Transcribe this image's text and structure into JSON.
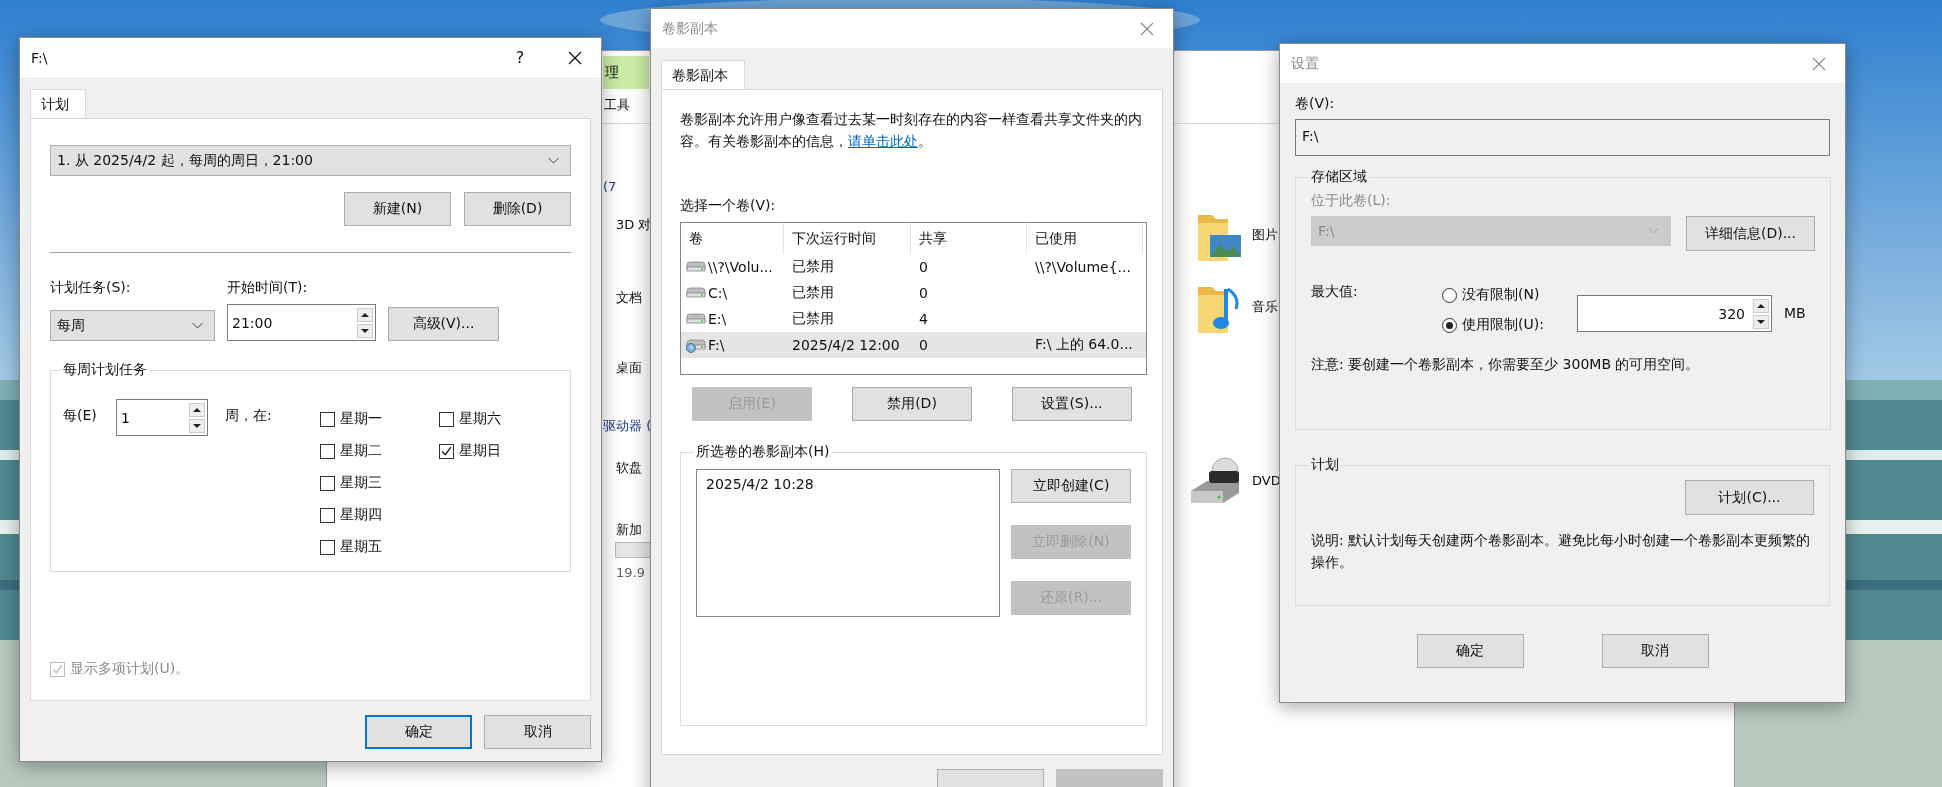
{
  "explorer": {
    "contextual_tab": "理",
    "ribbon_text": "工具",
    "left_items": [
      {
        "kind": "header",
        "text": "(7"
      },
      {
        "kind": "item",
        "text": "3D 对"
      },
      {
        "kind": "item",
        "text": "文档"
      },
      {
        "kind": "item",
        "text": "桌面"
      },
      {
        "kind": "header",
        "text": "驱动器 ("
      },
      {
        "kind": "item",
        "text": "软盘"
      },
      {
        "kind": "drive",
        "text": "新加",
        "detail": "19.9"
      }
    ],
    "right_items": [
      {
        "kind": "pictures",
        "text": "图片"
      },
      {
        "kind": "music",
        "text": "音乐"
      },
      {
        "kind": "dvd",
        "text": "DVD"
      }
    ]
  },
  "schedule_dialog": {
    "title": "F:\\",
    "active": true,
    "help": "?",
    "tabs": [
      {
        "label": "计划",
        "selected": true
      }
    ],
    "schedule_combo": "1. 从 2025/4/2 起，每周的周日，21:00",
    "top_buttons": [
      "新建(N)",
      "删除(D)"
    ],
    "task_label": "计划任务(S):",
    "task_value": "每周",
    "start_label": "开始时间(T):",
    "start_value": "21:00",
    "advanced_button": "高级(V)...",
    "group_title": "每周计划任务",
    "every_label": "每(E)",
    "every_value": "1",
    "weeks_label": "周，在:",
    "days": [
      {
        "label": "星期一",
        "checked": false
      },
      {
        "label": "星期二",
        "checked": false
      },
      {
        "label": "星期三",
        "checked": false
      },
      {
        "label": "星期四",
        "checked": false
      },
      {
        "label": "星期五",
        "checked": false
      },
      {
        "label": "星期六",
        "checked": false
      },
      {
        "label": "星期日",
        "checked": true
      }
    ],
    "multiple": {
      "label": "显示多项计划(U)。",
      "checked": true,
      "disabled": true
    },
    "buttons": [
      {
        "label": "确定",
        "default": true
      },
      {
        "label": "取消",
        "default": false
      }
    ]
  },
  "shadow_dialog": {
    "title": "卷影副本",
    "active": false,
    "tabs": [
      {
        "label": "卷影副本",
        "selected": true
      }
    ],
    "description": "卷影副本允许用户像查看过去某一时刻存在的内容一样查看共享文件夹的内容。有关卷影副本的信息，",
    "link": "请单击此处",
    "after_link": "。",
    "volumes_label": "选择一个卷(V):",
    "columns": [
      "卷",
      "下次运行时间",
      "共享",
      "已使用"
    ],
    "volumes": [
      {
        "kind": "drive",
        "name": "\\\\?\\Volu...",
        "next_run": "已禁用",
        "shares": "0",
        "used": "\\\\?\\Volume{...",
        "selected": false
      },
      {
        "kind": "drive",
        "name": "C:\\",
        "next_run": "已禁用",
        "shares": "0",
        "selected": false
      },
      {
        "kind": "drive",
        "name": "E:\\",
        "next_run": "已禁用",
        "shares": "4",
        "selected": false
      },
      {
        "kind": "scheduled",
        "name": "F:\\",
        "next_run": "2025/4/2 12:00",
        "shares": "0",
        "used": "F:\\ 上的 64.0...",
        "selected": true
      }
    ],
    "volume_buttons": [
      {
        "label": "启用(E)",
        "disabled": true
      },
      {
        "label": "禁用(D)",
        "disabled": false
      },
      {
        "label": "设置(S)...",
        "disabled": false
      }
    ],
    "copies_group": "所选卷的卷影副本(H)",
    "copies": [
      "2025/4/2 10:28"
    ],
    "copy_buttons": [
      {
        "label": "立即创建(C)",
        "disabled": false
      },
      {
        "label": "立即删除(N)",
        "disabled": true
      },
      {
        "label": "还原(R)...",
        "disabled": true
      }
    ],
    "buttons": [
      {
        "disabled": false
      },
      {
        "disabled": true
      }
    ]
  },
  "settings_dialog": {
    "title": "设置",
    "active": false,
    "volume_label": "卷(V):",
    "volume_value": "F:\\",
    "storage_group": "存储区域",
    "location_label": "位于此卷(L):",
    "location_value": "F:\\",
    "location_disabled": true,
    "details_button": "详细信息(D)...",
    "max_label": "最大值:",
    "limits": [
      {
        "label": "没有限制(N)",
        "selected": false
      },
      {
        "label": "使用限制(U):",
        "selected": true
      }
    ],
    "limit_value": "320",
    "unit": "MB",
    "note": "注意: 要创建一个卷影副本，你需要至少 300MB 的可用空间。",
    "schedule_group": "计划",
    "schedule_button": "计划(C)...",
    "description": "说明: 默认计划每天创建两个卷影副本。避免比每小时创建一个卷影副本更频繁的操作。",
    "buttons": [
      "确定",
      "取消"
    ]
  }
}
